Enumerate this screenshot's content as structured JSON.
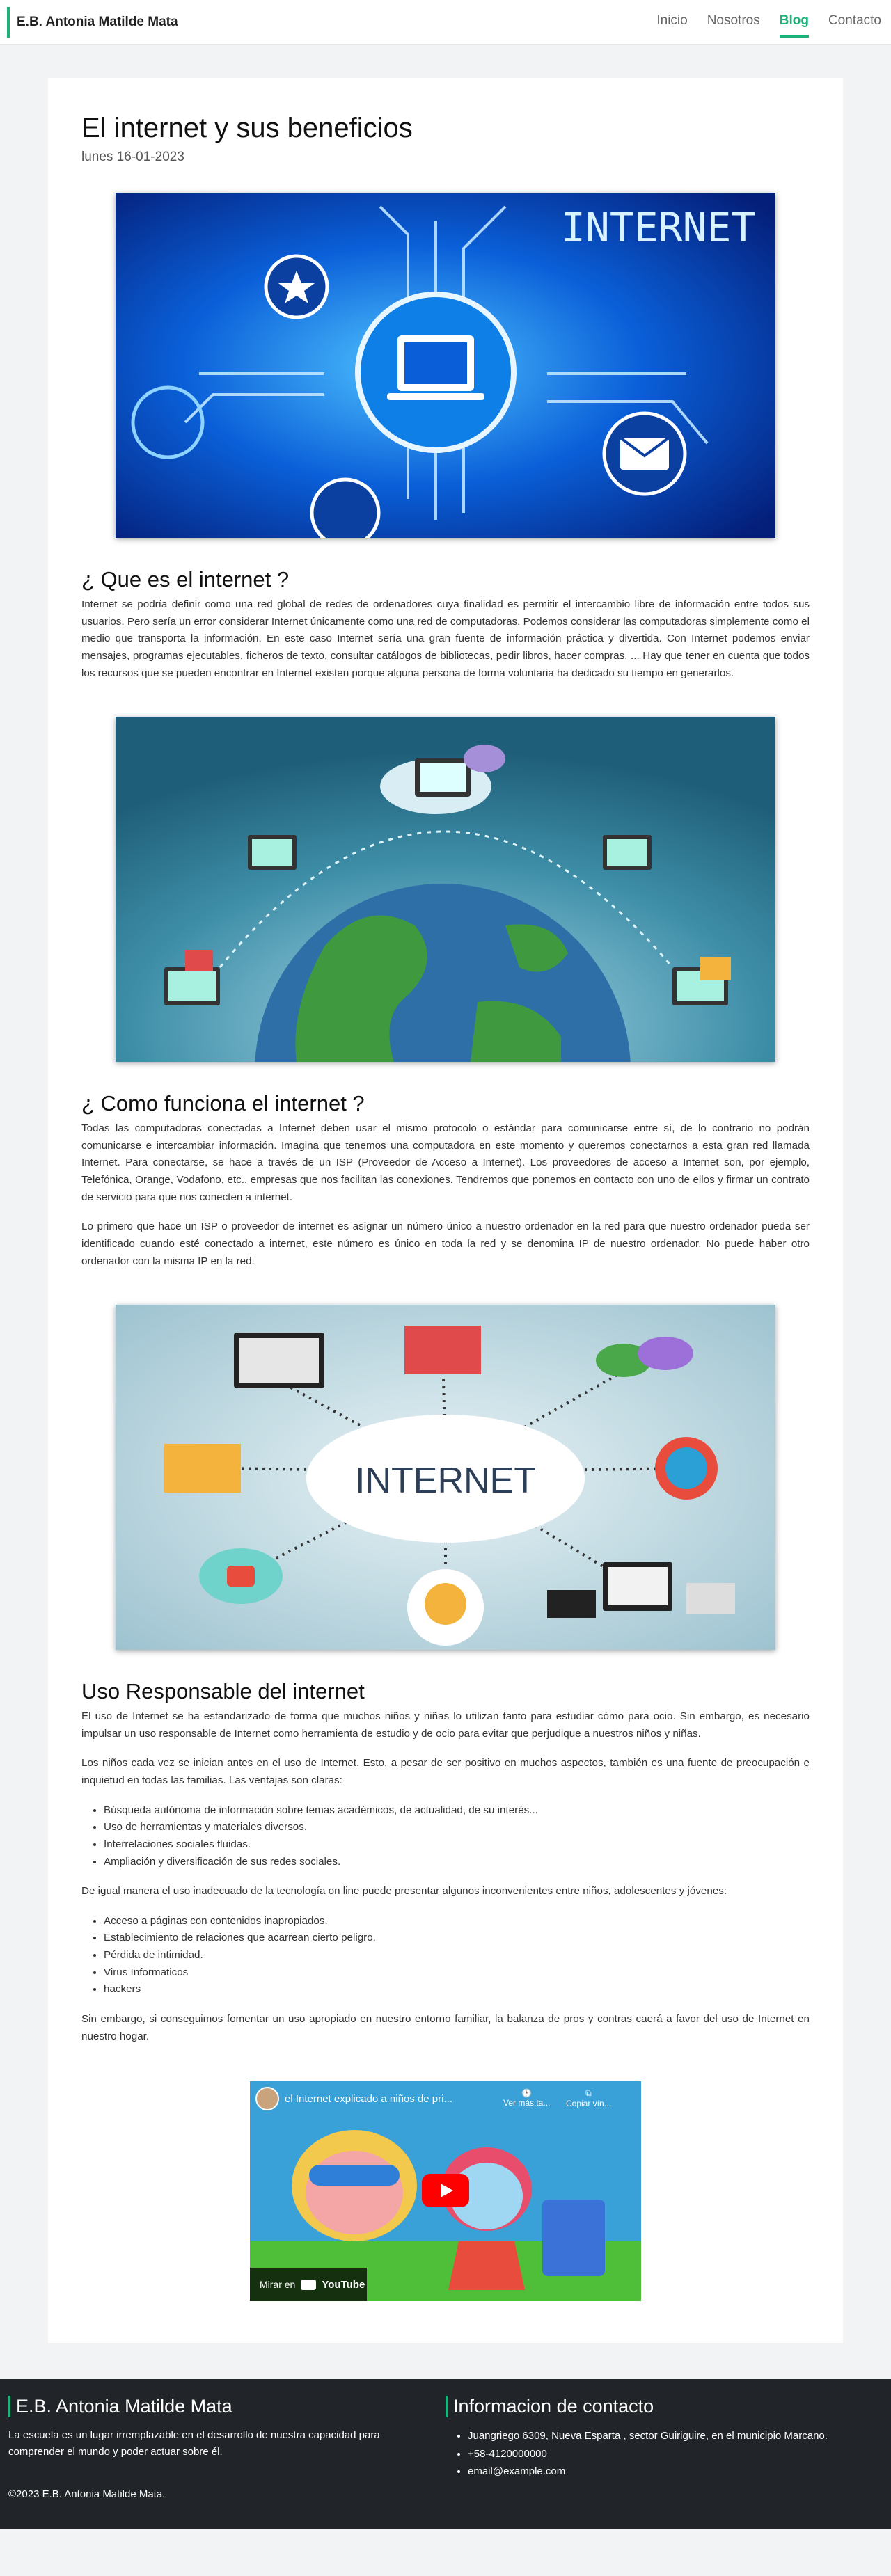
{
  "nav": {
    "brand": "E.B. Antonia Matilde Mata",
    "links": [
      "Inicio",
      "Nosotros",
      "Blog",
      "Contacto"
    ]
  },
  "article": {
    "title": "El internet y sus beneficios",
    "date": "lunes 16-01-2023",
    "s1": {
      "title": "¿ Que es el internet ?",
      "p1": "Internet se podría definir como una red global de redes de ordenadores cuya finalidad es permitir el intercambio libre de información entre todos sus usuarios. Pero sería un error considerar Internet únicamente como una red de computadoras. Podemos considerar las computadoras simplemente como el medio que transporta la información. En este caso Internet sería una gran fuente de información práctica y divertida. Con Internet podemos enviar mensajes, programas ejecutables, ficheros de texto, consultar catálogos de bibliotecas, pedir libros, hacer compras, ... Hay que tener en cuenta que todos los recursos que se pueden encontrar en Internet existen porque alguna persona de forma voluntaria ha dedicado su tiempo en generarlos."
    },
    "s2": {
      "title": "¿ Como funciona el internet ?",
      "p1": "Todas las computadoras conectadas a Internet deben usar el mismo protocolo o estándar para comunicarse entre sí, de lo contrario no podrán comunicarse e intercambiar información. Imagina que tenemos una computadora en este momento y queremos conectarnos a esta gran red llamada Internet. Para conectarse, se hace a través de un ISP (Proveedor de Acceso a Internet). Los proveedores de acceso a Internet son, por ejemplo, Telefónica, Orange, Vodafono, etc., empresas que nos facilitan las conexiones. Tendremos que ponemos en contacto con uno de ellos y firmar un contrato de servicio para que nos conecten a internet.",
      "p2": "Lo primero que hace un ISP o proveedor de internet es asignar un número único a nuestro ordenador en la red para que nuestro ordenador pueda ser identificado cuando esté conectado a internet, este número es único en toda la red y se denomina IP de nuestro ordenador. No puede haber otro ordenador con la misma IP en la red."
    },
    "s3": {
      "title": "Uso Responsable del internet",
      "p1": "El uso de Internet se ha estandarizado de forma que muchos niños y niñas lo utilizan tanto para estudiar cómo para ocio. Sin embargo, es necesario impulsar un uso responsable de Internet como herramienta de estudio y de ocio para evitar que perjudique a nuestros niños y niñas.",
      "p2": "Los niños cada vez se inician antes en el uso de Internet. Esto, a pesar de ser positivo en muchos aspectos, también es una fuente de preocupación e inquietud en todas las familias. Las ventajas son claras:",
      "list1": [
        "Búsqueda autónoma de información sobre temas académicos, de actualidad, de su interés...",
        "Uso de herramientas y materiales diversos.",
        "Interrelaciones sociales fluidas.",
        "Ampliación y diversificación de sus redes sociales."
      ],
      "p3": "De igual manera el uso inadecuado de la tecnología on line puede presentar algunos inconvenientes entre niños, adolescentes y jóvenes:",
      "list2": [
        "Acceso a páginas con contenidos inapropiados.",
        "Establecimiento de relaciones que acarrean cierto peligro.",
        "Pérdida de intimidad.",
        "Virus Informaticos",
        "hackers"
      ],
      "p4": "Sin embargo, si conseguimos fomentar un uso apropiado en nuestro entorno familiar, la balanza de pros y contras caerá a favor del uso de Internet en nuestro hogar."
    },
    "video": {
      "title": "el Internet explicado a niños de pri...",
      "later": "Ver más ta...",
      "copy": "Copiar vín...",
      "watch": "Mirar en",
      "yt": "YouTube"
    },
    "img2_label": "INTERNET",
    "img1_label": "INTERNET"
  },
  "footer": {
    "title1": "E.B. Antonia Matilde Mata",
    "desc": "La escuela es un lugar irremplazable en el desarrollo de nuestra capacidad para comprender el mundo y poder actuar sobre él.",
    "title2": "Informacion de contacto",
    "contact": [
      "Juangriego 6309, Nueva Esparta , sector Guiriguire, en el municipio Marcano.",
      "+58-4120000000",
      "email@example.com"
    ],
    "copyright": "©2023 E.B. Antonia Matilde Mata."
  }
}
